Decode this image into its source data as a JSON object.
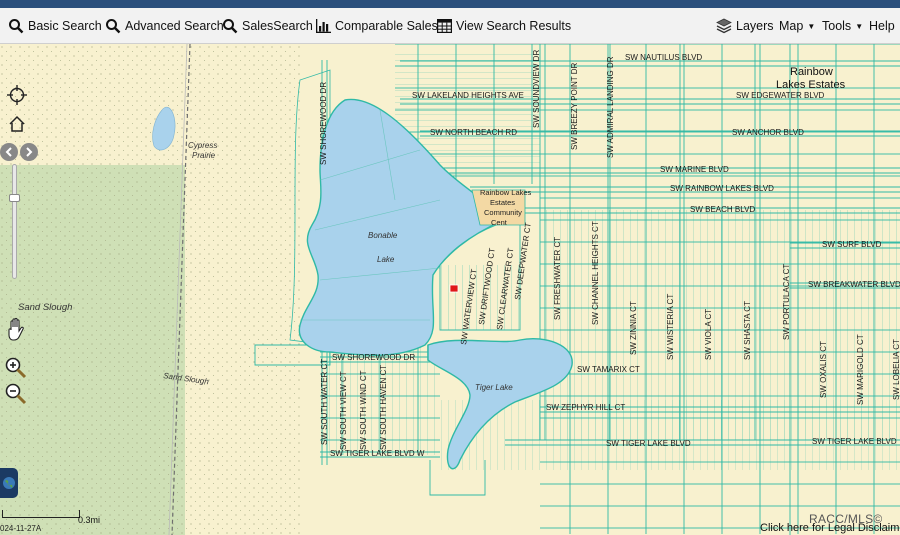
{
  "toolbar": {
    "basic_search": "Basic Search",
    "advanced_search": "Advanced Search",
    "sales_search": "SalesSearch",
    "comparable_sales": "Comparable Sales",
    "view_search_results": "View Search Results",
    "layers": "Layers",
    "map": "Map",
    "tools": "Tools",
    "help": "Help"
  },
  "map": {
    "places": {
      "rainbow_lakes_1": "Rainbow",
      "rainbow_lakes_2": "Lakes Estates",
      "cypress_1": "Cypress",
      "cypress_2": "Prairie",
      "bonable_1": "Bonable",
      "bonable_2": "Lake",
      "tiger_lake": "Tiger Lake",
      "sand_slough_area": "Sand Slough",
      "sand_slough_line": "Sand Slough",
      "community_1": "Rainbow Lakes",
      "community_2": "Estates",
      "community_3": "Community",
      "community_4": "Cent"
    },
    "streets": {
      "nautilus": "SW NAUTILUS BLVD",
      "lakeland": "SW LAKELAND HEIGHTS AVE",
      "edgewater": "SW EDGEWATER BLVD",
      "north_beach": "SW NORTH BEACH RD",
      "anchor": "SW ANCHOR BLVD",
      "marine": "SW MARINE BLVD",
      "rainbow_lakes": "SW RAINBOW LAKES BLVD",
      "beach": "SW BEACH BLVD",
      "surf": "SW SURF BLVD",
      "breakwater": "SW BREAKWATER BLVD",
      "shorewood_dr_v": "SW SHOREWOOD DR",
      "shorewood_dr_h": "SW SHOREWOOD DR",
      "soundview": "SW SOUNDVIEW DR",
      "breezy_point": "SW BREEZY POINT DR",
      "admiral_landing": "SW ADMIRAL LANDING DR",
      "driftwood": "SW DRIFTWOOD CT",
      "waterview": "SW WATERVIEW CT",
      "clearwater": "SW CLEARWATER CT",
      "deepwater": "SW DEEPWATER CT",
      "freshwater": "SW FRESHWATER CT",
      "channel_heights": "SW CHANNEL HEIGHTS CT",
      "zinnia": "SW ZINNIA CT",
      "wisteria": "SW WISTERIA CT",
      "viola": "SW VIOLA CT",
      "shasta": "SW SHASTA CT",
      "portulaca": "SW PORTULACA CT",
      "oxalis": "SW OXALIS CT",
      "marigold": "SW MARIGOLD CT",
      "lobelia": "SW LOBELIA CT",
      "tamarix": "SW TAMARIX CT",
      "zephyr_hill": "SW ZEPHYR HILL CT",
      "tiger_lake_1": "SW TIGER LAKE BLVD",
      "tiger_lake_2": "SW TIGER LAKE BLVD",
      "tiger_lake_w": "SW TIGER LAKE BLVD W",
      "south_water": "SW SOUTH WATER CT",
      "south_view": "SW SOUTH VIEW CT",
      "south_wind": "SW SOUTH WIND CT",
      "south_haven": "SW SOUTH HAVEN CT"
    }
  },
  "scale": {
    "label": "0.3mi"
  },
  "footer": {
    "date": "024-11-27A",
    "copyright": "RACC/MLS©",
    "disclaimer": "Click here for Legal Disclaim"
  },
  "colors": {
    "land": "#f8f1cf",
    "water": "#a9d2ec",
    "parcel": "#2fb9a6",
    "forest": "#cfe0b6",
    "toolbar": "#f2f2f2",
    "header": "#2b4f7c",
    "selected_parcel": "#e01818"
  }
}
